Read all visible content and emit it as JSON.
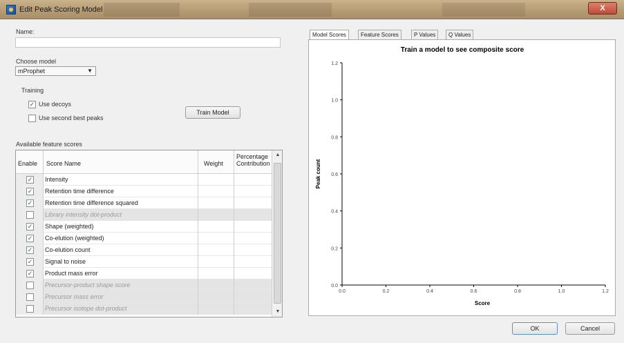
{
  "window": {
    "title": "Edit Peak Scoring Model",
    "close_label": "X"
  },
  "name_field": {
    "label": "Name:",
    "value": ""
  },
  "model": {
    "label": "Choose model",
    "selected": "mProphet"
  },
  "training": {
    "label": "Training",
    "use_decoys": {
      "label": "Use decoys",
      "checked": true
    },
    "use_second_best": {
      "label": "Use second best peaks",
      "checked": false
    },
    "train_button": "Train Model"
  },
  "features": {
    "label": "Available feature scores",
    "columns": [
      "Enable",
      "Score Name",
      "Weight",
      "Percentage Contribution"
    ],
    "rows": [
      {
        "enabled": true,
        "name": "Intensity",
        "disabled": false
      },
      {
        "enabled": true,
        "name": "Retention time difference",
        "disabled": false
      },
      {
        "enabled": true,
        "name": "Retention time difference squared",
        "disabled": false
      },
      {
        "enabled": false,
        "name": "Library intensity dot-product",
        "disabled": true
      },
      {
        "enabled": true,
        "name": "Shape (weighted)",
        "disabled": false
      },
      {
        "enabled": true,
        "name": "Co-elution (weighted)",
        "disabled": false
      },
      {
        "enabled": true,
        "name": "Co-elution count",
        "disabled": false
      },
      {
        "enabled": true,
        "name": "Signal to noise",
        "disabled": false
      },
      {
        "enabled": true,
        "name": "Product mass error",
        "disabled": false
      },
      {
        "enabled": false,
        "name": "Precursor-product shape score",
        "disabled": true
      },
      {
        "enabled": false,
        "name": "Precursor mass error",
        "disabled": true
      },
      {
        "enabled": false,
        "name": "Precursor isotope dot-product",
        "disabled": true
      }
    ]
  },
  "tabs": [
    "Model Scores",
    "Feature Scores",
    "P Values",
    "Q Values"
  ],
  "chart_data": {
    "type": "bar",
    "title": "Train a model to see composite score",
    "xlabel": "Score",
    "ylabel": "Peak count",
    "xlim": [
      0,
      1.2
    ],
    "ylim": [
      0,
      1.2
    ],
    "xticks": [
      "0.0",
      "0.2",
      "0.4",
      "0.6",
      "0.8",
      "1.0",
      "1.2"
    ],
    "yticks": [
      "0.0",
      "0.2",
      "0.4",
      "0.6",
      "0.8",
      "1.0",
      "1.2"
    ],
    "series": [],
    "grid": false,
    "colors": {
      "axis": "#000000",
      "background": "#ffffff"
    }
  },
  "buttons": {
    "ok": "OK",
    "cancel": "Cancel"
  }
}
